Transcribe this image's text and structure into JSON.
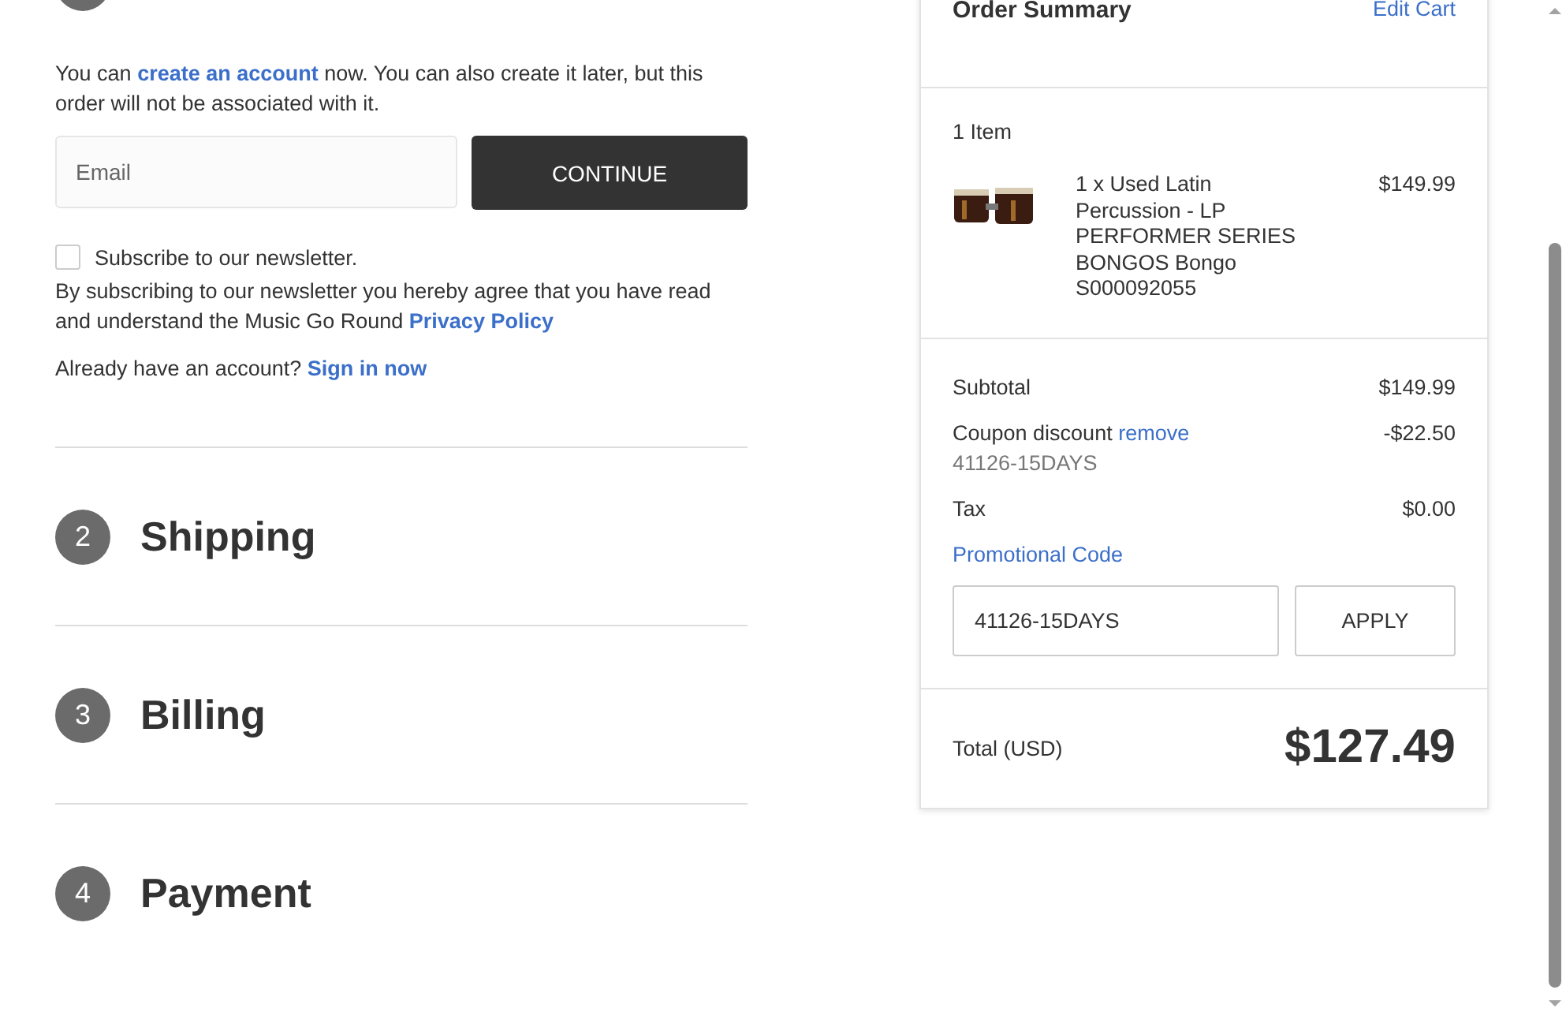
{
  "account_notice": {
    "before": "You can",
    "link": "create an account",
    "after": "now. You can also create it later, but this order will not be associated with it."
  },
  "email": {
    "placeholder": "Email"
  },
  "continue_button": "CONTINUE",
  "newsletter": {
    "label": "Subscribe to our newsletter.",
    "checked": false
  },
  "consent": {
    "text": "By subscribing to our newsletter you hereby agree that you have read and understand the Music Go Round",
    "link": "Privacy Policy"
  },
  "signin": {
    "text": "Already have an account?",
    "link": "Sign in now"
  },
  "steps": [
    {
      "number": "2",
      "title": "Shipping"
    },
    {
      "number": "3",
      "title": "Billing"
    },
    {
      "number": "4",
      "title": "Payment"
    }
  ],
  "summary": {
    "title": "Order Summary",
    "edit_link": "Edit Cart",
    "item_count": "1 Item",
    "items": [
      {
        "description": "1 x Used Latin Percussion - LP PERFORMER SERIES BONGOS Bongo S000092055",
        "price": "$149.99"
      }
    ],
    "lines": [
      {
        "kind": "plain",
        "label": "Subtotal",
        "value": "$149.99"
      },
      {
        "kind": "coupon",
        "label": "Coupon discount",
        "link": "remove",
        "code": "41126-15DAYS",
        "value": "-$22.50"
      },
      {
        "kind": "plain",
        "label": "Tax",
        "value": "$0.00"
      }
    ],
    "promo": {
      "label": "Promotional Code",
      "value": "41126-15DAYS",
      "button": "APPLY"
    },
    "total": {
      "label": "Total (USD)",
      "value": "$127.49"
    }
  }
}
